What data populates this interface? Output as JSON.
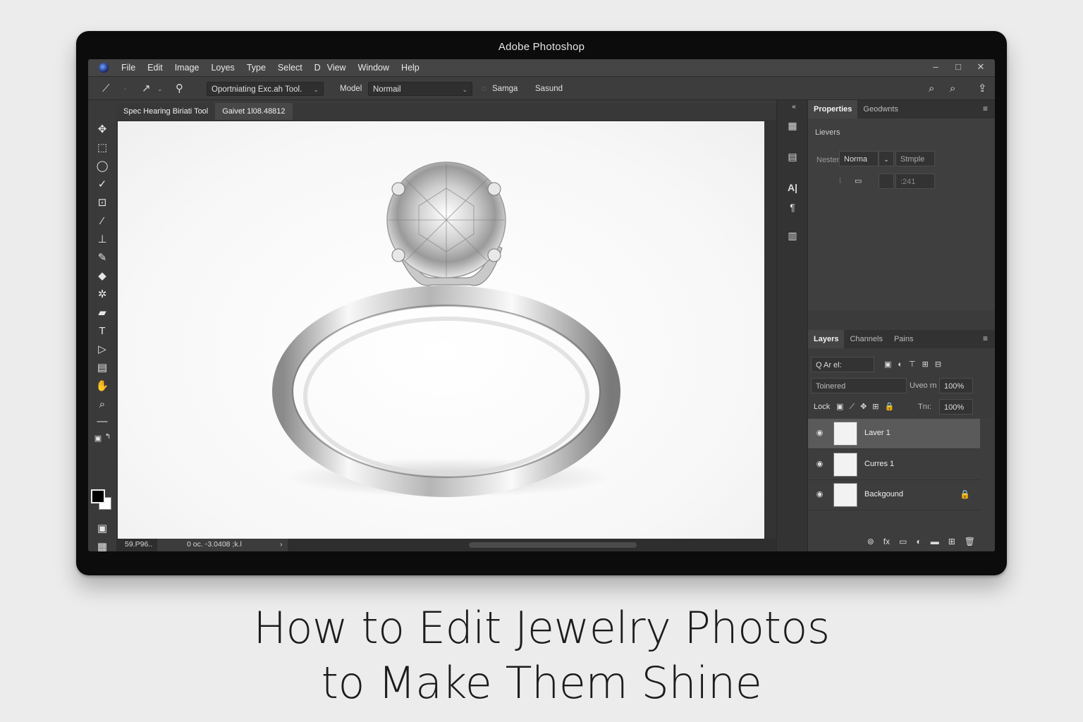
{
  "window": {
    "title": "Adobe Photoshop",
    "controls": [
      "–",
      "□",
      "✕"
    ]
  },
  "menu": [
    "File",
    "Edit",
    "Image",
    "Loyes",
    "Type",
    "Select",
    "D",
    "View",
    "Window",
    "Help"
  ],
  "options": {
    "tool_preset": "Oportniating Exc.ah Tool.",
    "model_label": "Model",
    "model_value": "Normail",
    "samga_label": "Samga",
    "sasund_label": "Sasund"
  },
  "doc_tabs": [
    "Spec Hearing Biriati Tool",
    "Gaivet 1l08.48812"
  ],
  "status": {
    "zoom": "59.P96..",
    "info": "0 oc. ◦3.0408 ;k.l",
    "arrow": "›"
  },
  "properties_panel": {
    "tabs": [
      "Properties",
      "Geodwnts"
    ],
    "section": "Lievers",
    "mode_label": "Nester",
    "mode_value": "Norma",
    "mode_alt": "Stmple",
    "value_field": ":241"
  },
  "layers_panel": {
    "tabs": [
      "Layers",
      "Channels",
      "Pains"
    ],
    "filter": "Q Ar el:",
    "blend_mode": "Toinered",
    "opacity_label": "Uveo rn",
    "opacity_value": "100%",
    "lock_label": "Lock",
    "fill_label": "Tnı:",
    "fill_value": "100%",
    "layers": [
      {
        "name": "Laver 1",
        "selected": true
      },
      {
        "name": "Curres 1",
        "selected": false
      },
      {
        "name": "Backgound",
        "selected": false,
        "locked": true
      }
    ]
  },
  "headline": {
    "line1": "How to Edit Jewelry Photos",
    "line2": "to Make Them Shine"
  }
}
